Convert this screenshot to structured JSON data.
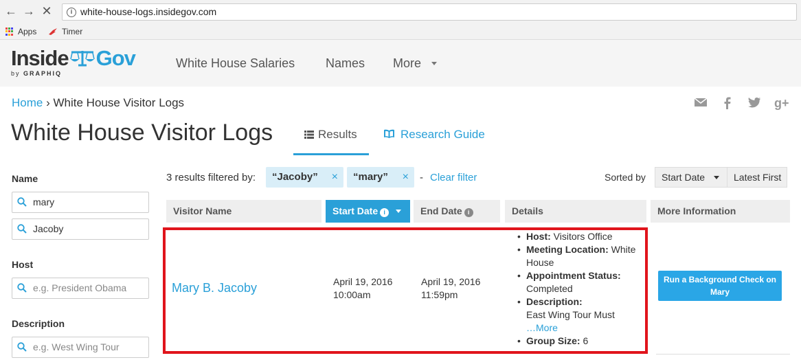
{
  "browser": {
    "url": "white-house-logs.insidegov.com",
    "bookmarks": [
      {
        "label": "Apps"
      },
      {
        "label": "Timer"
      }
    ]
  },
  "site": {
    "logo_inside": "Inside",
    "logo_gov": "Gov",
    "logo_by": "by",
    "logo_graphiq": "GRAPHIQ",
    "nav": [
      "White House Salaries",
      "Names",
      "More"
    ]
  },
  "breadcrumb": {
    "home": "Home",
    "separator": "›",
    "current": "White House Visitor Logs"
  },
  "page": {
    "title": "White House Visitor Logs",
    "tabs": [
      {
        "label": "Results"
      },
      {
        "label": "Research Guide"
      }
    ]
  },
  "sidebar": {
    "name_label": "Name",
    "name_values": [
      "mary",
      "Jacoby"
    ],
    "host_label": "Host",
    "host_placeholder": "e.g. President Obama",
    "description_label": "Description",
    "description_placeholder": "e.g. West Wing Tour"
  },
  "filters": {
    "summary": "3 results filtered by:",
    "chips": [
      "“Jacoby”",
      "“mary”"
    ],
    "chip_remove": "×",
    "dash": "-",
    "clear_label": "Clear filter"
  },
  "sort": {
    "label": "Sorted by",
    "field": "Start Date",
    "order": "Latest First"
  },
  "table": {
    "headers": [
      "Visitor Name",
      "Start Date",
      "End Date",
      "Details",
      "More Information"
    ],
    "row": {
      "visitor_name": "Mary B. Jacoby",
      "start_date": "April 19, 2016",
      "start_time": "10:00am",
      "end_date": "April 19, 2016",
      "end_time": "11:59pm",
      "details": {
        "host_key": "Host:",
        "host_value": "Visitors Office",
        "location_key": "Meeting Location:",
        "location_value": "White House",
        "status_key": "Appointment Status:",
        "status_value": "Completed",
        "description_key": "Description:",
        "description_value": "East Wing Tour Must",
        "more_link": "…More",
        "group_key": "Group Size:",
        "group_value": "6"
      },
      "action_button": "Run a Background Check on Mary"
    }
  },
  "colors": {
    "accent": "#2aa0d8",
    "highlight_border": "#e0141c"
  }
}
